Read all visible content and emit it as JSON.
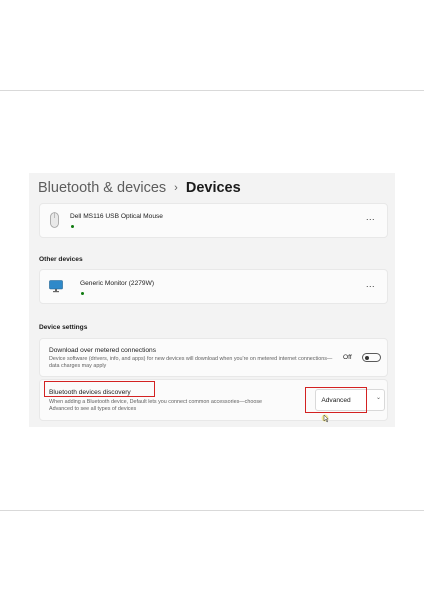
{
  "header": {
    "parent": "Bluetooth & devices",
    "separator": "›",
    "current": "Devices"
  },
  "devices": [
    {
      "name": "Dell MS116 USB Optical Mouse",
      "icon": "mouse-icon",
      "status_color": "#0f7b0f",
      "more": "..."
    }
  ],
  "other_devices": {
    "label": "Other devices",
    "items": [
      {
        "name": "Generic Monitor (2279W)",
        "icon": "monitor-icon",
        "status_color": "#0f7b0f",
        "more": "..."
      }
    ]
  },
  "device_settings": {
    "label": "Device settings",
    "metered": {
      "title": "Download over metered connections",
      "description": "Device software (drivers, info, and apps) for new devices will download when you're on metered internet connections—data charges may apply",
      "toggle_label": "Off",
      "toggle_on": false
    },
    "discovery": {
      "title": "Bluetooth devices discovery",
      "description_line1": "When adding a Bluetooth device, Default lets you connect common accessories—choose",
      "description_line2": "Advanced to see all types of devices",
      "selected": "Advanced",
      "chevron": "⌄"
    }
  },
  "colors": {
    "highlight": "#d32222",
    "window_bg": "#f3f3f3",
    "card_bg": "#fbfbfb",
    "status_green": "#0f7b0f"
  }
}
